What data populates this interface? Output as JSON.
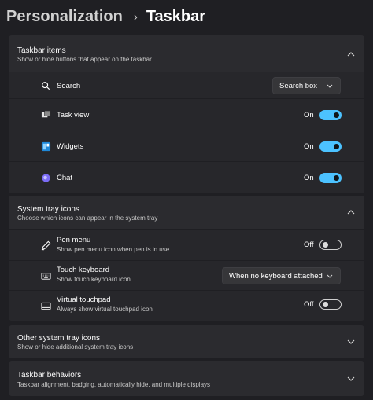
{
  "breadcrumb": {
    "parent": "Personalization",
    "separator": "›",
    "current": "Taskbar"
  },
  "sections": {
    "taskbar_items": {
      "title": "Taskbar items",
      "description": "Show or hide buttons that appear on the taskbar",
      "expanded": true,
      "search": {
        "label": "Search",
        "value": "Search box",
        "icon": "search-icon"
      },
      "task_view": {
        "label": "Task view",
        "state": "On",
        "on": true,
        "icon": "task-view-icon"
      },
      "widgets": {
        "label": "Widgets",
        "state": "On",
        "on": true,
        "icon": "widgets-icon"
      },
      "chat": {
        "label": "Chat",
        "state": "On",
        "on": true,
        "icon": "chat-icon"
      }
    },
    "system_tray": {
      "title": "System tray icons",
      "description": "Choose which icons can appear in the system tray",
      "expanded": true,
      "pen_menu": {
        "label": "Pen menu",
        "description": "Show pen menu icon when pen is in use",
        "state": "Off",
        "on": false,
        "icon": "pen-icon"
      },
      "touch_keyboard": {
        "label": "Touch keyboard",
        "description": "Show touch keyboard icon",
        "value": "When no keyboard attached",
        "icon": "keyboard-icon"
      },
      "virtual_touchpad": {
        "label": "Virtual touchpad",
        "description": "Always show virtual touchpad icon",
        "state": "Off",
        "on": false,
        "icon": "touchpad-icon"
      }
    },
    "other_tray": {
      "title": "Other system tray icons",
      "description": "Show or hide additional system tray icons",
      "expanded": false
    },
    "behaviors": {
      "title": "Taskbar behaviors",
      "description": "Taskbar alignment, badging, automatically hide, and multiple displays",
      "expanded": false
    }
  },
  "colors": {
    "accent": "#4cc2ff",
    "background": "#1f1f23",
    "card": "#2b2b2f"
  }
}
